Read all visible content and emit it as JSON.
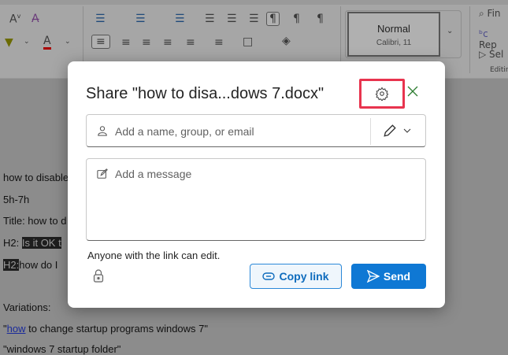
{
  "ribbon": {
    "style_name": "Normal",
    "style_font": "Calibri, 11",
    "find": "Fin",
    "replace": "Rep",
    "select": "Sel",
    "editing": "Editin"
  },
  "document": {
    "lines": [
      "how to disable",
      "5h-7h",
      "Title: how to d"
    ],
    "h2_label": "H2:",
    "h2_a": "Is it OK t",
    "h2_b": "how do I",
    "variations": "Variations:",
    "var1_link": "how",
    "var1_rest": " to change startup programs windows 7\"",
    "var2": "\"windows 7 startup folder\""
  },
  "dialog": {
    "title": "Share \"how to disa...dows 7.docx\"",
    "to_placeholder": "Add a name, group, or email",
    "message_placeholder": "Add a message",
    "link_info": "Anyone with the link can edit.",
    "copy_link": "Copy link",
    "send": "Send"
  },
  "colors": {
    "accent": "#0f78d4",
    "highlight": "#e8344e"
  }
}
